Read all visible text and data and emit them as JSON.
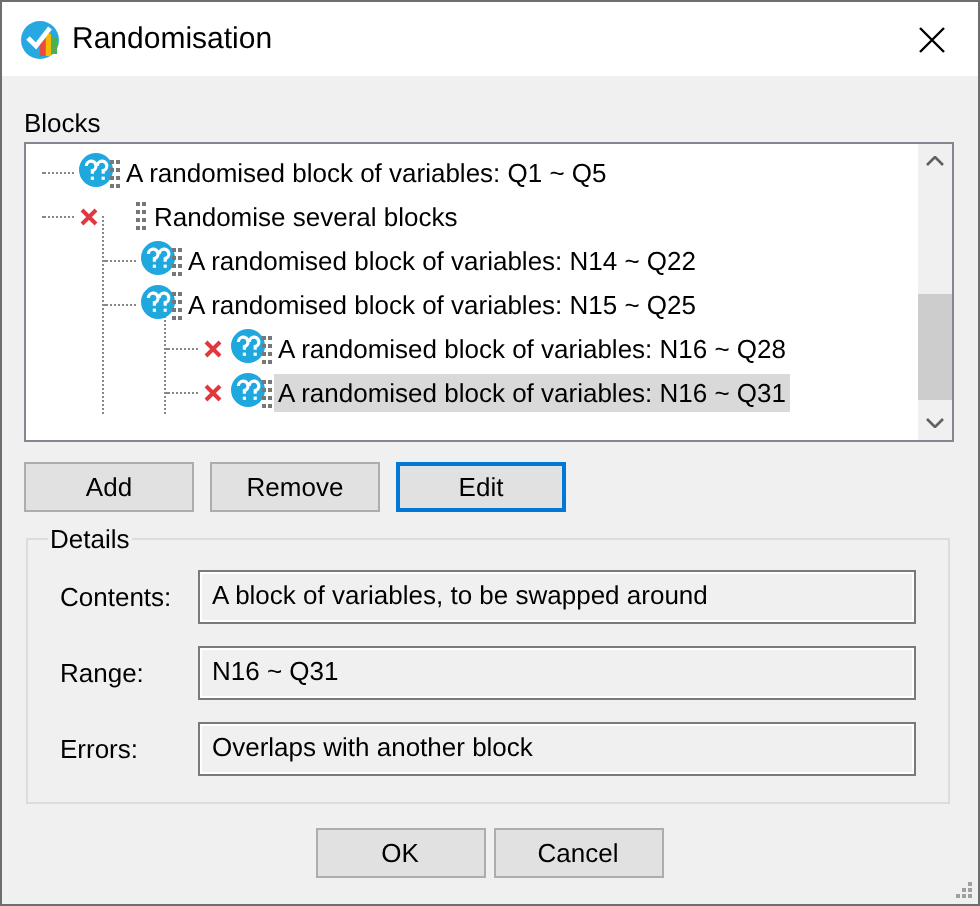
{
  "window": {
    "title": "Randomisation"
  },
  "blocks": {
    "label": "Blocks",
    "items": [
      {
        "kind": "block",
        "text": "A randomised block of variables: Q1 ~ Q5",
        "error": false,
        "selected": false
      },
      {
        "kind": "group",
        "text": "Randomise several blocks",
        "error": true,
        "selected": false,
        "children": [
          {
            "kind": "block",
            "text": "A randomised block of variables: N14 ~ Q22",
            "error": false,
            "selected": false
          },
          {
            "kind": "block",
            "text": "A randomised block of variables: N15 ~ Q25",
            "error": false,
            "selected": false,
            "children": [
              {
                "kind": "block",
                "text": "A randomised block of variables: N16 ~ Q28",
                "error": true,
                "selected": false
              },
              {
                "kind": "block",
                "text": "A randomised block of variables: N16 ~ Q31",
                "error": true,
                "selected": true
              }
            ]
          }
        ]
      }
    ]
  },
  "buttons": [
    {
      "label": "Add",
      "focused": false
    },
    {
      "label": "Remove",
      "focused": false
    },
    {
      "label": "Edit",
      "focused": true
    }
  ],
  "details": {
    "label": "Details",
    "fields": [
      {
        "label": "Contents:",
        "value": "A block of variables, to be swapped around"
      },
      {
        "label": "Range:",
        "value": "N16 ~ Q31"
      },
      {
        "label": "Errors:",
        "value": "Overlaps with another block"
      }
    ]
  },
  "footer_buttons": [
    {
      "label": "OK"
    },
    {
      "label": "Cancel"
    }
  ]
}
